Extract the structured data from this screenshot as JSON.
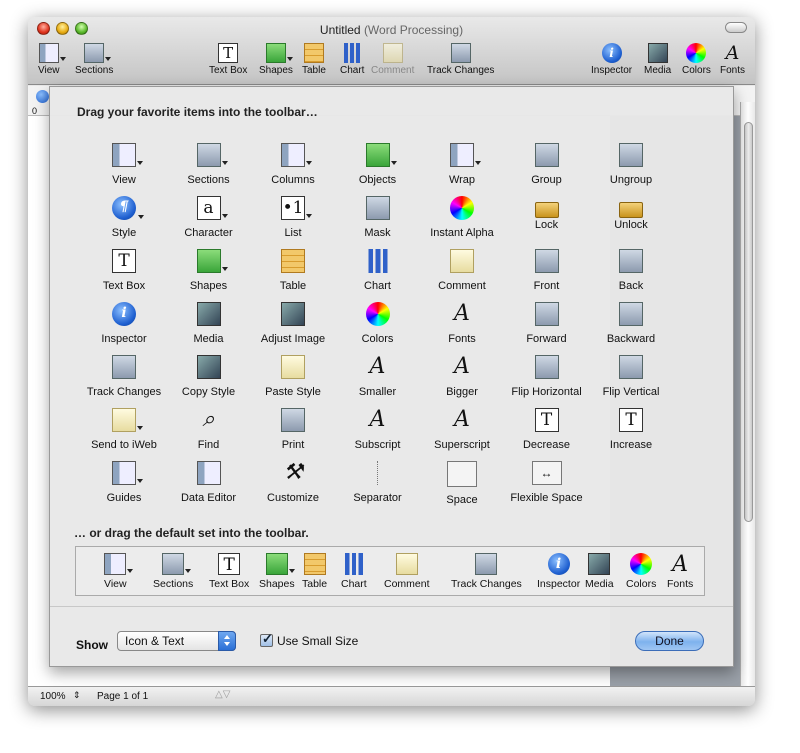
{
  "window": {
    "title": "Untitled",
    "subtitle": "(Word Processing)"
  },
  "toolbar": [
    {
      "label": "View",
      "icon": "view-icon"
    },
    {
      "label": "Sections",
      "icon": "sections-icon"
    },
    {
      "label": "Text Box",
      "icon": "textbox-icon"
    },
    {
      "label": "Shapes",
      "icon": "shapes-icon"
    },
    {
      "label": "Table",
      "icon": "table-icon"
    },
    {
      "label": "Chart",
      "icon": "chart-icon"
    },
    {
      "label": "Comment",
      "icon": "comment-icon"
    },
    {
      "label": "Track Changes",
      "icon": "track-changes-icon"
    },
    {
      "label": "Inspector",
      "icon": "inspector-icon"
    },
    {
      "label": "Media",
      "icon": "media-icon"
    },
    {
      "label": "Colors",
      "icon": "colors-icon"
    },
    {
      "label": "Fonts",
      "icon": "fonts-icon"
    }
  ],
  "ruler": {
    "zero": "0"
  },
  "sheet": {
    "heading": "Drag your favorite items into the toolbar…",
    "items": [
      "View",
      "Sections",
      "Columns",
      "Objects",
      "Wrap",
      "Group",
      "Ungroup",
      "Style",
      "Character",
      "List",
      "Mask",
      "Instant Alpha",
      "Lock",
      "Unlock",
      "Text Box",
      "Shapes",
      "Table",
      "Chart",
      "Comment",
      "Front",
      "Back",
      "Inspector",
      "Media",
      "Adjust Image",
      "Colors",
      "Fonts",
      "Forward",
      "Backward",
      "Track Changes",
      "Copy Style",
      "Paste Style",
      "Smaller",
      "Bigger",
      "Flip Horizontal",
      "Flip Vertical",
      "Send to iWeb",
      "Find",
      "Print",
      "Subscript",
      "Superscript",
      "Decrease",
      "Increase",
      "Guides",
      "Data Editor",
      "Customize",
      "Separator",
      "Space",
      "Flexible Space"
    ],
    "default_heading": "… or drag the default set into the toolbar.",
    "default_items": [
      "View",
      "Sections",
      "Text Box",
      "Shapes",
      "Table",
      "Chart",
      "Comment",
      "Track Changes",
      "Inspector",
      "Media",
      "Colors",
      "Fonts"
    ],
    "show_label": "Show",
    "show_value": "Icon & Text",
    "small_size_label": "Use Small Size",
    "done_label": "Done"
  },
  "status": {
    "zoom": "100%",
    "page": "Page 1 of 1"
  }
}
